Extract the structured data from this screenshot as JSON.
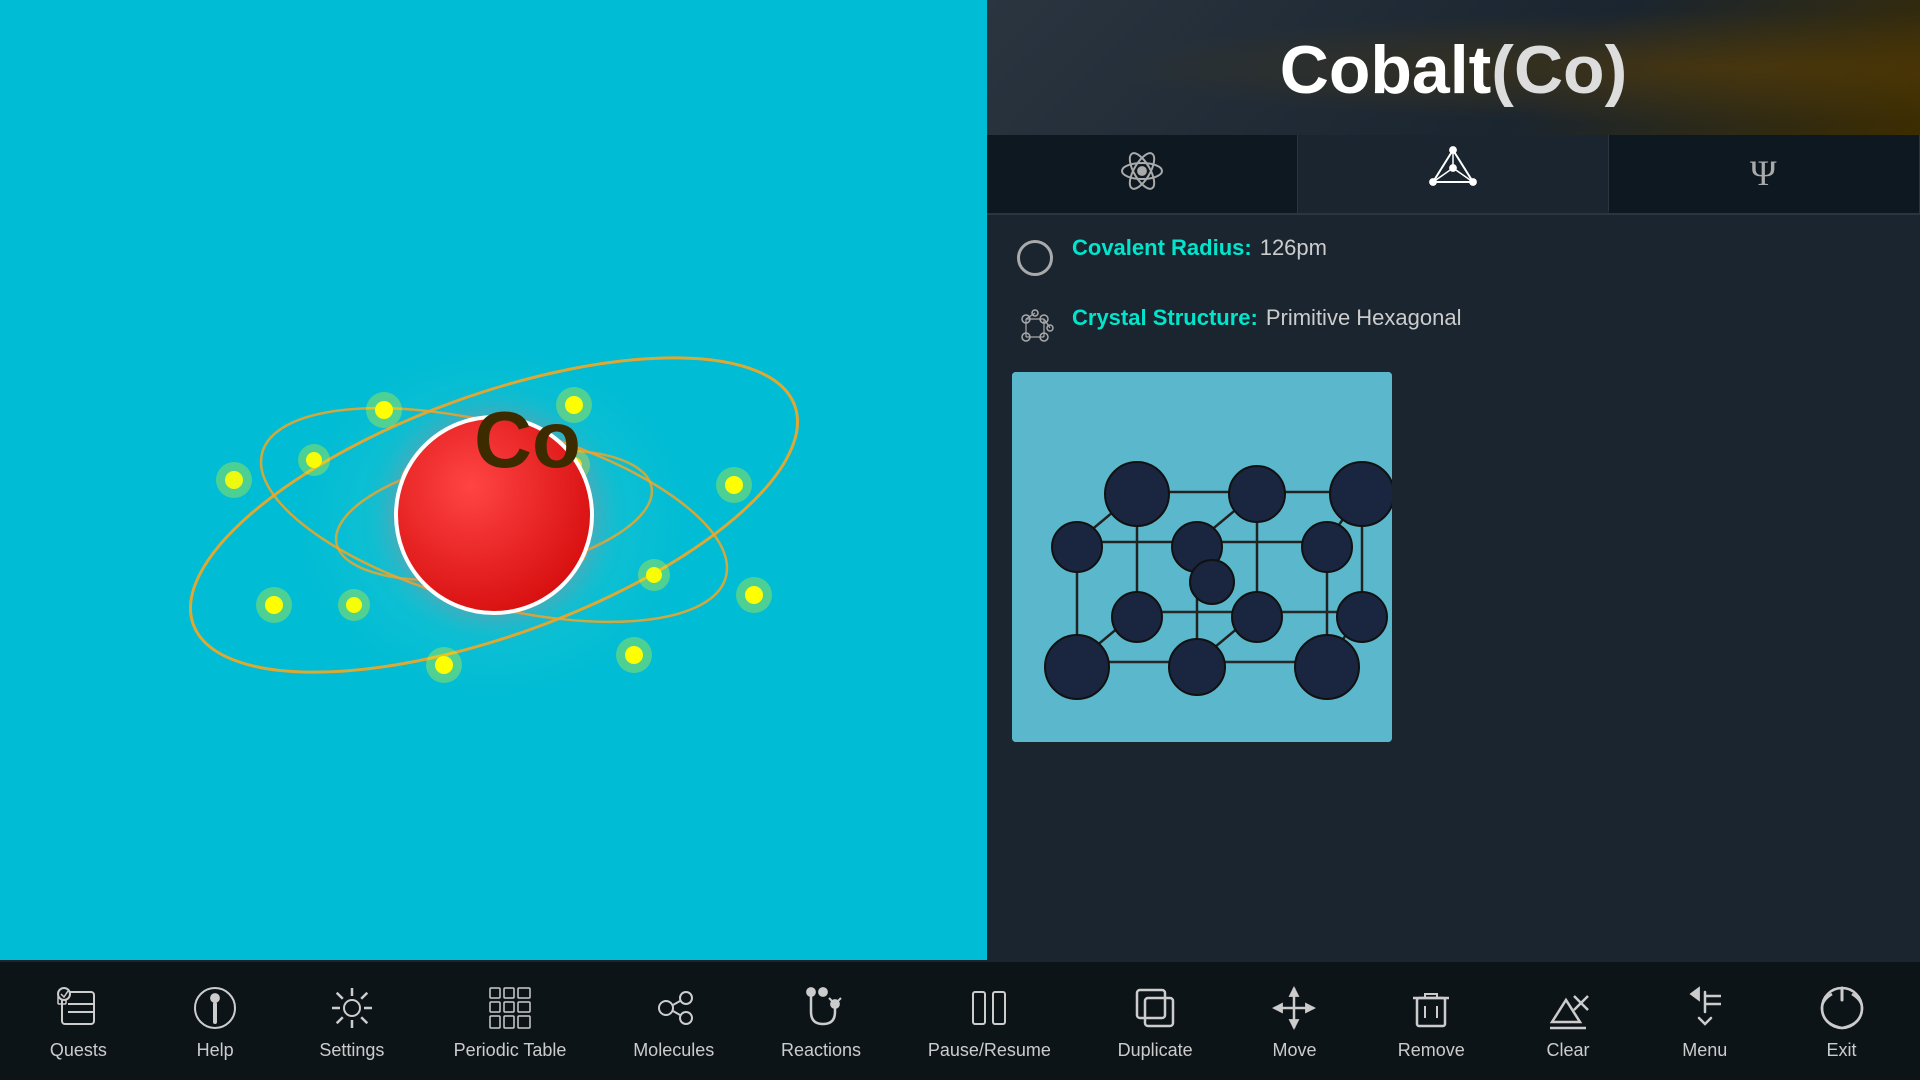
{
  "element": {
    "name": "Cobalt",
    "symbol": "Co",
    "covalent_radius_label": "Covalent Radius:",
    "covalent_radius_value": "126pm",
    "crystal_structure_label": "Crystal Structure:",
    "crystal_structure_value": "Primitive Hexagonal"
  },
  "tabs": [
    {
      "id": "atom",
      "icon": "atom-icon",
      "active": false
    },
    {
      "id": "structure",
      "icon": "structure-icon",
      "active": true
    },
    {
      "id": "psi",
      "icon": "psi-icon",
      "active": false
    }
  ],
  "toolbar": {
    "items": [
      {
        "id": "quests",
        "label": "Quests",
        "icon": "quests-icon"
      },
      {
        "id": "help",
        "label": "Help",
        "icon": "help-icon"
      },
      {
        "id": "settings",
        "label": "Settings",
        "icon": "settings-icon"
      },
      {
        "id": "periodic-table",
        "label": "Periodic Table",
        "icon": "periodic-table-icon"
      },
      {
        "id": "molecules",
        "label": "Molecules",
        "icon": "molecules-icon"
      },
      {
        "id": "reactions",
        "label": "Reactions",
        "icon": "reactions-icon"
      },
      {
        "id": "pause-resume",
        "label": "Pause/Resume",
        "icon": "pause-resume-icon"
      },
      {
        "id": "duplicate",
        "label": "Duplicate",
        "icon": "duplicate-icon"
      },
      {
        "id": "move",
        "label": "Move",
        "icon": "move-icon"
      },
      {
        "id": "remove",
        "label": "Remove",
        "icon": "remove-icon"
      },
      {
        "id": "clear",
        "label": "Clear",
        "icon": "clear-icon"
      },
      {
        "id": "menu",
        "label": "Menu",
        "icon": "menu-icon"
      },
      {
        "id": "exit",
        "label": "Exit",
        "icon": "exit-icon"
      }
    ]
  },
  "colors": {
    "accent": "#00e5cc",
    "background_left": "#00bcd4",
    "background_right": "#1a2530",
    "toolbar": "#0d1418",
    "nucleus": "#cc0000"
  }
}
